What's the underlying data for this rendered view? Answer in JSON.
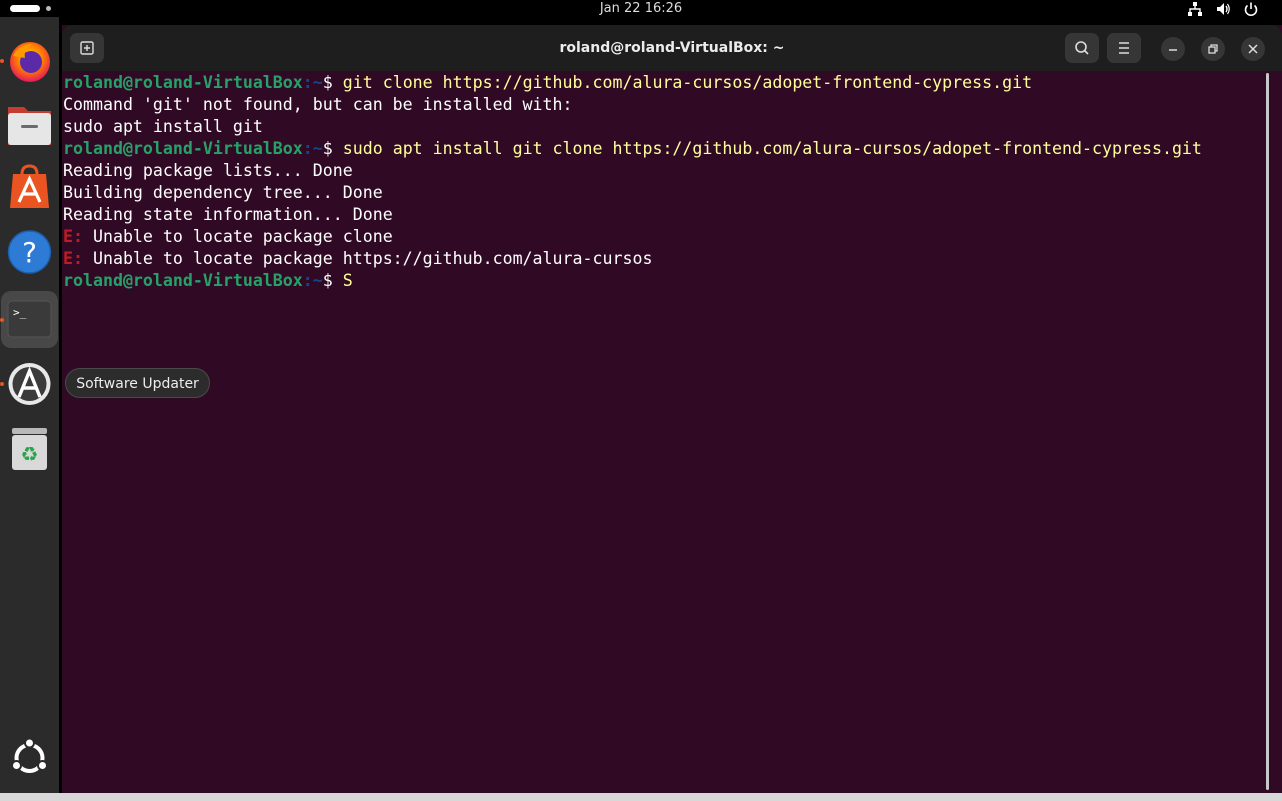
{
  "topbar": {
    "clock": "Jan 22  16:26"
  },
  "tray": {
    "icons": [
      "network-icon",
      "volume-icon",
      "power-icon"
    ]
  },
  "dock": {
    "items": [
      {
        "name": "firefox",
        "icon": "firefox-icon",
        "running": true
      },
      {
        "name": "files",
        "icon": "files-icon",
        "running": false
      },
      {
        "name": "app-center",
        "icon": "app-center-icon",
        "running": false
      },
      {
        "name": "help",
        "icon": "help-icon",
        "running": false
      },
      {
        "name": "terminal",
        "icon": "terminal-icon",
        "running": true,
        "active": true
      },
      {
        "name": "software-updater",
        "icon": "software-updater-icon",
        "running": true
      },
      {
        "name": "trash",
        "icon": "trash-icon",
        "running": false
      }
    ],
    "apps_grid_icon": "show-apps-icon",
    "tooltip": "Software Updater"
  },
  "window": {
    "title": "roland@roland-VirtualBox: ~",
    "buttons": [
      "new-tab",
      "search",
      "menu",
      "minimize",
      "maximize",
      "close"
    ]
  },
  "terminal": {
    "prompt_user": "roland@roland-VirtualBox",
    "prompt_path": ":~",
    "prompt_sign": "$ ",
    "lines": [
      {
        "type": "prompt",
        "cmd": "git clone https://github.com/alura-cursos/adopet-frontend-cypress.git"
      },
      {
        "type": "out",
        "text": "Command 'git' not found, but can be installed with:"
      },
      {
        "type": "out",
        "text": "sudo apt install git"
      },
      {
        "type": "prompt",
        "cmd": "sudo apt install git clone https://github.com/alura-cursos/adopet-frontend-cypress.git"
      },
      {
        "type": "out",
        "text": "Reading package lists... Done"
      },
      {
        "type": "out",
        "text": "Building dependency tree... Done"
      },
      {
        "type": "out",
        "text": "Reading state information... Done"
      },
      {
        "type": "err",
        "prefix": "E:",
        "text": " Unable to locate package clone"
      },
      {
        "type": "err",
        "prefix": "E:",
        "text": " Unable to locate package https://github.com/alura-cursos"
      },
      {
        "type": "prompt",
        "cmd": "S"
      }
    ]
  },
  "colors": {
    "terminal_bg": "#300a24",
    "prompt_user": "#26a269",
    "prompt_path": "#12488b",
    "error": "#c01c28",
    "accent": "#e95420"
  }
}
